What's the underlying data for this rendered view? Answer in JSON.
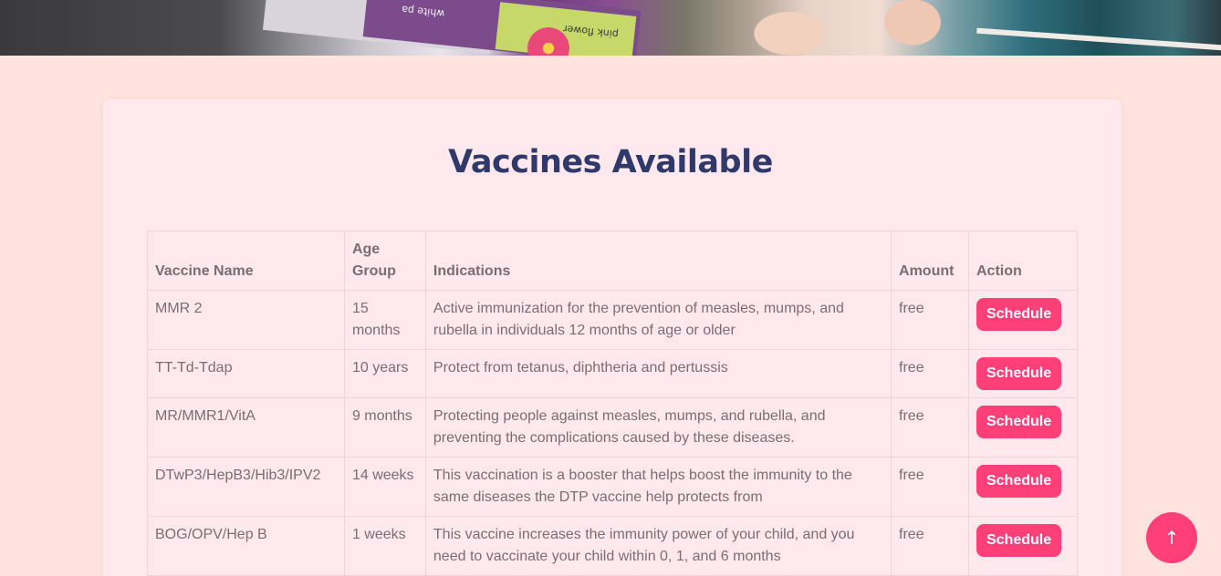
{
  "hero": {
    "card_text_1": "white pa",
    "card_text_2": "pink flower"
  },
  "page": {
    "title": "Vaccines Available"
  },
  "table": {
    "headers": [
      "Vaccine Name",
      "Age Group",
      "Indications",
      "Amount",
      "Action"
    ],
    "rows": [
      {
        "name": "MMR 2",
        "age": "15 months",
        "indication": "Active immunization for the prevention of measles, mumps, and rubella in individuals 12 months of age or older",
        "amount": "free",
        "action": "Schedule"
      },
      {
        "name": "TT-Td-Tdap",
        "age": "10 years",
        "indication": "Protect from tetanus, diphtheria and pertussis",
        "amount": "free",
        "action": "Schedule"
      },
      {
        "name": "MR/MMR1/VitA",
        "age": "9 months",
        "indication": "Protecting people against measles, mumps, and rubella, and preventing the complications caused by these diseases.",
        "amount": "free",
        "action": "Schedule"
      },
      {
        "name": "DTwP3/HepB3/Hib3/IPV2",
        "age": "14 weeks",
        "indication": "This vaccination is a booster that helps boost the immunity to the same diseases the DTP vaccine help protects from",
        "amount": "free",
        "action": "Schedule"
      },
      {
        "name": "BOG/OPV/Hep B",
        "age": "1 weeks",
        "indication": "This vaccine increases the immunity power of your child, and you need to vaccinate your child within 0, 1, and 6 months",
        "amount": "free",
        "action": "Schedule"
      }
    ]
  },
  "scroll_top": {
    "icon": "arrow-up-icon",
    "glyph": "↑"
  },
  "colors": {
    "page_bg": "#ffe3de",
    "panel_bg": "#ffe8ee",
    "title": "#2f3a6b",
    "accent": "#fe3f78",
    "text": "#7a6d73"
  }
}
